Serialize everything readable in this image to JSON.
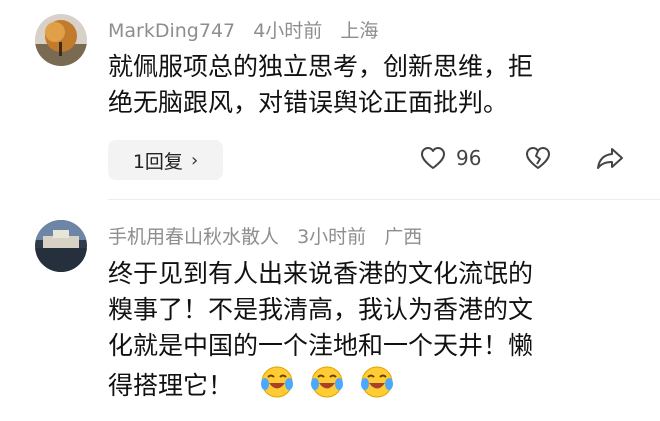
{
  "comments": [
    {
      "username": "MarkDing747",
      "time": "4小时前",
      "location": "上海",
      "text_lines": [
        "就佩服项总的独立思考，创新思维，拒",
        "绝无脑跟风，对错误舆论正面批判。"
      ],
      "reply_label": "1回复",
      "reply_chevron": "›",
      "like_count": "96"
    },
    {
      "username": "手机用春山秋水散人",
      "time": "3小时前",
      "location": "广西",
      "text_lines": [
        "终于见到有人出来说香港的文化流氓的",
        "糗事了！不是我清高，我认为香港的文",
        "化就是中国的一个洼地和一个天井！懒",
        "得搭理它！"
      ],
      "emoji_count": 3,
      "emoji_name": "laughing-crying-emoji"
    }
  ],
  "icons": {
    "like": "heart-icon",
    "dislike": "broken-heart-icon",
    "share": "share-icon"
  }
}
